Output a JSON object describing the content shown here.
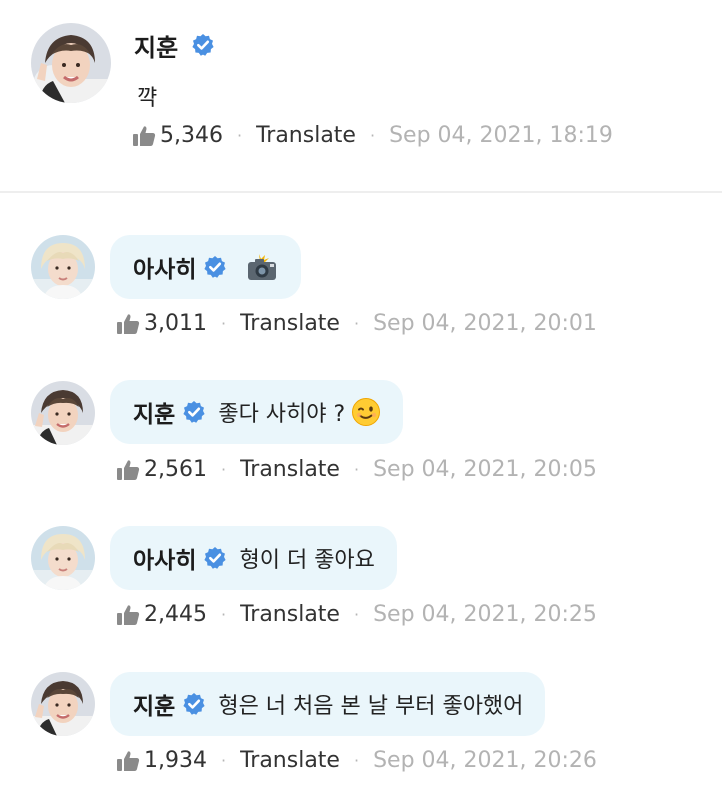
{
  "post": {
    "author": "지훈",
    "text": "꺅",
    "likes": "5,346",
    "translate_label": "Translate",
    "date": "Sep 04, 2021, 18:19",
    "separator": "·"
  },
  "comments": [
    {
      "author": "아사히",
      "text": "",
      "emoji": "camera-flash-emoji",
      "likes": "3,011",
      "translate_label": "Translate",
      "date": "Sep 04, 2021, 20:01",
      "separator": "·"
    },
    {
      "author": "지훈",
      "text": "좋다 사히야 ?",
      "emoji": "winking-face-emoji",
      "likes": "2,561",
      "translate_label": "Translate",
      "date": "Sep 04, 2021, 20:05",
      "separator": "·"
    },
    {
      "author": "아사히",
      "text": "형이 더 좋아요",
      "emoji": "",
      "likes": "2,445",
      "translate_label": "Translate",
      "date": "Sep 04, 2021, 20:25",
      "separator": "·"
    },
    {
      "author": "지훈",
      "text": "형은 너 처음 본 날 부터 좋아했어",
      "emoji": "",
      "likes": "1,934",
      "translate_label": "Translate",
      "date": "Sep 04, 2021, 20:26",
      "separator": "·"
    }
  ],
  "colors": {
    "verified_badge": "#4a90e2",
    "bubble_bg": "#eaf6fb",
    "date_text": "#b3b3b3",
    "like_icon": "#8a8a8a"
  },
  "icons": {
    "like": "thumbs-up-icon",
    "verified": "verified-badge-icon"
  }
}
